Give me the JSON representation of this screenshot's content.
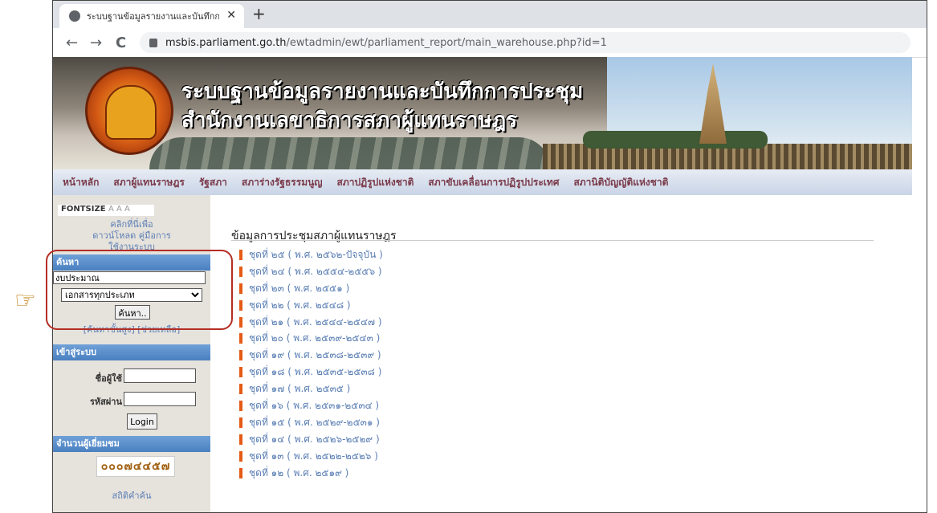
{
  "browser": {
    "tab_title": "ระบบฐานข้อมูลรายงานและบันทึกการประชุม",
    "tab_close": "✕",
    "new_tab": "+",
    "back": "←",
    "forward": "→",
    "reload": "C",
    "url_host": "msbis.parliament.go.th",
    "url_path": "/ewtadmin/ewt/parliament_report/main_warehouse.php?id=1"
  },
  "banner": {
    "title_line1": "ระบบฐานข้อมูลรายงานและบันทึกการประชุม",
    "title_line2": "สำนักงานเลขาธิการสภาผู้แทนราษฎร"
  },
  "topnav": {
    "items": [
      "หน้าหลัก",
      "สภาผู้แทนราษฎร",
      "รัฐสภา",
      "สภาร่างรัฐธรรมนูญ",
      "สภาปฏิรูปแห่งชาติ",
      "สภาขับเคลื่อนการปฏิรูปประเทศ",
      "สภานิติบัญญัติแห่งชาติ"
    ]
  },
  "sidebar": {
    "fontsize_label": "FONTSIZE",
    "fontsize_options": "A A A",
    "download_link": "คลิกที่นี่เพื่อดาวน์โหลด คู่มือการใช้งานระบบ",
    "search_header": "ค้นหา",
    "search_value": "งบประมาณ",
    "search_select": "เอกสารทุกประเภท",
    "search_button": "ค้นหา..",
    "advanced_links": "[ค้นหาขั้นสูง] [ช่วยเหลือ]",
    "login_header": "เข้าสู่ระบบ",
    "username_label": "ชื่อผู้ใช้",
    "password_label": "รหัสผ่าน",
    "login_button": "Login",
    "visitors_header": "จำนวนผู้เยี่ยมชม",
    "visitor_count": "๐๐๐๗๔๔๕๗",
    "stats_link": "สถิติคำค้น"
  },
  "main": {
    "title": "ข้อมูลการประชุมสภาผู้แทนราษฎร",
    "sessions": [
      "ชุดที่ ๒๕ ( พ.ศ. ๒๕๖๒-ปัจจุบัน )",
      "ชุดที่ ๒๔ ( พ.ศ. ๒๕๕๔-๒๕๕๖ )",
      "ชุดที่ ๒๓ ( พ.ศ. ๒๕๕๑ )",
      "ชุดที่ ๒๒ ( พ.ศ. ๒๕๔๘ )",
      "ชุดที่ ๒๑ ( พ.ศ. ๒๕๔๔-๒๕๔๗ )",
      "ชุดที่ ๒๐ ( พ.ศ. ๒๕๓๙-๒๕๔๓ )",
      "ชุดที่ ๑๙ ( พ.ศ. ๒๕๓๘-๒๕๓๙ )",
      "ชุดที่ ๑๘ ( พ.ศ. ๒๕๓๕-๒๕๓๘ )",
      "ชุดที่ ๑๗ ( พ.ศ. ๒๕๓๕ )",
      "ชุดที่ ๑๖ ( พ.ศ. ๒๕๓๑-๒๕๓๔ )",
      "ชุดที่ ๑๕ ( พ.ศ. ๒๕๒๙-๒๕๓๑ )",
      "ชุดที่ ๑๔ ( พ.ศ. ๒๕๒๖-๒๕๒๙ )",
      "ชุดที่ ๑๓ ( พ.ศ. ๒๕๒๒-๒๕๒๖ )",
      "ชุดที่ ๑๒ ( พ.ศ. ๒๕๑๙ )"
    ]
  },
  "annotation": {
    "pointer": "☞"
  },
  "colors": {
    "accent_red": "#b42d24",
    "link_blue": "#5b7fb4",
    "bullet_orange": "#e55b16",
    "nav_text": "#7a3a4a"
  }
}
